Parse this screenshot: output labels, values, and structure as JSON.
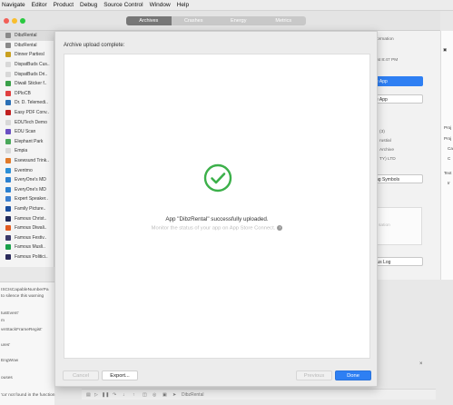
{
  "menubar": {
    "items": [
      "Navigate",
      "Editor",
      "Product",
      "Debug",
      "Source Control",
      "Window",
      "Help"
    ]
  },
  "toolbar": {
    "tabs": [
      {
        "label": "Archives",
        "active": true
      },
      {
        "label": "Crashes",
        "active": false
      },
      {
        "label": "Energy",
        "active": false
      },
      {
        "label": "Metrics",
        "active": false
      }
    ]
  },
  "sidebar": {
    "apps": [
      {
        "name": "DibzRental",
        "color": "#8a8a8a",
        "selected": true
      },
      {
        "name": "DibzRental",
        "color": "#8a8a8a"
      },
      {
        "name": "Dinner Partiesl",
        "color": "#c9a020"
      },
      {
        "name": "DispatBuds Cus..",
        "color": "#d8d8d8"
      },
      {
        "name": "DispatBuds Dri..",
        "color": "#d8d8d8"
      },
      {
        "name": "Diwali Sticker f..",
        "color": "#3aa049"
      },
      {
        "name": "DPloCB",
        "color": "#e04040"
      },
      {
        "name": "Dr. D. Telemedi..",
        "color": "#2a6fb5"
      },
      {
        "name": "Easy PDF Conv..",
        "color": "#c02020"
      },
      {
        "name": "EDUTech Demo",
        "color": "#d8d8d8"
      },
      {
        "name": "EDU Scan",
        "color": "#6a4fc2"
      },
      {
        "name": "Elephant Park",
        "color": "#4aa85a"
      },
      {
        "name": "Empia",
        "color": "#d8d8d8"
      },
      {
        "name": "Esewsund Trink..",
        "color": "#e07a2a"
      },
      {
        "name": "Eventmo",
        "color": "#2a8fd8"
      },
      {
        "name": "EveryOne's MD",
        "color": "#2a80d0"
      },
      {
        "name": "EveryOne's MD",
        "color": "#2a80d0"
      },
      {
        "name": "Expert Speaker..",
        "color": "#3a7fd0"
      },
      {
        "name": "Family Picture..",
        "color": "#1a4fa0"
      },
      {
        "name": "Famous Christ..",
        "color": "#202a5a"
      },
      {
        "name": "Famous Diwali..",
        "color": "#e05a20"
      },
      {
        "name": "Famous Festiv..",
        "color": "#3a3a6a"
      },
      {
        "name": "Famous Musli..",
        "color": "#1aa04a"
      },
      {
        "name": "Famous Politici..",
        "color": "#2a2a5a"
      }
    ]
  },
  "console": {
    "lines": [
      "ISCIsCapableNumberPa",
      "to silence this warning",
      "tusEvent'",
      "m",
      "veStackFrameRegist'",
      "ures'",
      "EngWow",
      "ouses",
      "'ca' not found in the function"
    ]
  },
  "inspector": {
    "labels": [
      "nformation",
      "at 8:47 PM",
      "(3)",
      "rustial",
      "Archive",
      "TY) LTD",
      "ng Symbols",
      "sation",
      "tus Log"
    ],
    "primary_button": "e App",
    "secondary_button": "e App"
  },
  "farright": {
    "labels": [
      "Proj",
      "Proj",
      "Ca",
      "C",
      "Text",
      "Ir"
    ]
  },
  "debugbar": {
    "target": "DibzRental"
  },
  "sheet": {
    "title": "Archive upload complete:",
    "success_message": "App \"DibzRental\" successfully uploaded.",
    "monitor_text": "Monitor the status of your app on App Store Connect.",
    "check_color": "#3cb04a",
    "buttons": {
      "cancel": "Cancel",
      "export": "Export...",
      "previous": "Previous",
      "done": "Done"
    }
  }
}
